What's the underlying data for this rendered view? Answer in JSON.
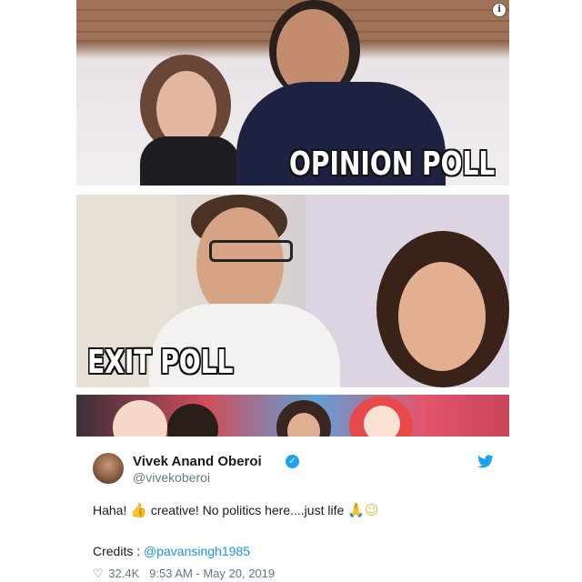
{
  "images": {
    "top_caption": "OPINION POLL",
    "middle_caption": "EXIT POLL",
    "info_icon": "i"
  },
  "tweet": {
    "author_name": "Vivek Anand Oberoi",
    "handle": "@vivekoberoi",
    "verified_icon": "✓",
    "text_before": "Haha!",
    "emoji_thumbs": "👍",
    "text_middle": "creative! No politics here....just life",
    "emoji_pray": "🙏",
    "emoji_smile": "☺",
    "credits_label": "Credits :",
    "credits_link": "@pavansingh1985",
    "likes": "32.4K",
    "timestamp": "9:53 AM - May 20, 2019"
  },
  "colors": {
    "link": "#1b95e0",
    "twitter_blue": "#1da1f2",
    "muted": "#657786"
  },
  "icons": {
    "like": "heart-icon",
    "verified": "verified-badge-icon",
    "brand": "twitter-bird-icon",
    "info": "info-icon"
  }
}
